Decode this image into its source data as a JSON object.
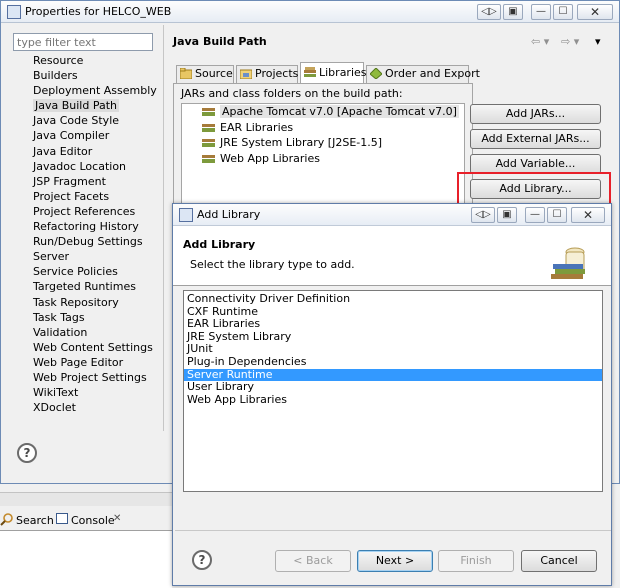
{
  "properties_window": {
    "title": "Properties for HELCO_WEB",
    "caption_buttons": [
      "◁▷",
      "▣",
      "—",
      "☐",
      "✕"
    ],
    "filter_placeholder": "type filter text",
    "tree_items": [
      {
        "label": "Resource"
      },
      {
        "label": "Builders"
      },
      {
        "label": "Deployment Assembly"
      },
      {
        "label": "Java Build Path",
        "selected": true
      },
      {
        "label": "Java Code Style"
      },
      {
        "label": "Java Compiler"
      },
      {
        "label": "Java Editor"
      },
      {
        "label": "Javadoc Location"
      },
      {
        "label": "JSP Fragment"
      },
      {
        "label": "Project Facets"
      },
      {
        "label": "Project References"
      },
      {
        "label": "Refactoring History"
      },
      {
        "label": "Run/Debug Settings"
      },
      {
        "label": "Server"
      },
      {
        "label": "Service Policies"
      },
      {
        "label": "Targeted Runtimes"
      },
      {
        "label": "Task Repository"
      },
      {
        "label": "Task Tags"
      },
      {
        "label": "Validation"
      },
      {
        "label": "Web Content Settings"
      },
      {
        "label": "Web Page Editor"
      },
      {
        "label": "Web Project Settings"
      },
      {
        "label": "WikiText"
      },
      {
        "label": "XDoclet"
      }
    ],
    "page_title": "Java Build Path",
    "nav_back": "⇦ ▾",
    "nav_forward": "⇨ ▾",
    "nav_menu": "▾",
    "tabs": [
      {
        "label": "Source",
        "icon": "source-folder-icon"
      },
      {
        "label": "Projects",
        "icon": "projects-icon"
      },
      {
        "label": "Libraries",
        "icon": "libraries-icon",
        "active": true
      },
      {
        "label": "Order and Export",
        "icon": "order-export-icon"
      }
    ],
    "jars_label": "JARs and class folders on the build path:",
    "libraries": [
      {
        "label": "Apache Tomcat v7.0 [Apache Tomcat v7.0]"
      },
      {
        "label": "EAR Libraries"
      },
      {
        "label": "JRE System Library [J2SE-1.5]"
      },
      {
        "label": "Web App Libraries"
      }
    ],
    "buttons": {
      "add_jars": "Add JARs...",
      "add_external_jars": "Add External JARs...",
      "add_variable": "Add Variable...",
      "add_library": "Add Library..."
    },
    "help_glyph": "?"
  },
  "bottom_views": {
    "search_tab": "Search",
    "console_tab": "Console",
    "console_close": "✕"
  },
  "add_library_dialog": {
    "title": "Add Library",
    "caption_buttons": [
      "◁▷",
      "▣",
      "—",
      "☐",
      "✕"
    ],
    "heading": "Add Library",
    "description": "Select the library type to add.",
    "library_types": [
      {
        "label": "Connectivity Driver Definition"
      },
      {
        "label": "CXF Runtime"
      },
      {
        "label": "EAR Libraries"
      },
      {
        "label": "JRE System Library"
      },
      {
        "label": "JUnit"
      },
      {
        "label": "Plug-in Dependencies"
      },
      {
        "label": "Server Runtime",
        "selected": true
      },
      {
        "label": "User Library"
      },
      {
        "label": "Web App Libraries"
      }
    ],
    "help_glyph": "?",
    "buttons": {
      "back": "< Back",
      "next": "Next >",
      "finish": "Finish",
      "cancel": "Cancel"
    }
  },
  "colors": {
    "selection": "#3399ff",
    "highlight_box": "#e8202a",
    "window_border": "#6d8bb5"
  }
}
